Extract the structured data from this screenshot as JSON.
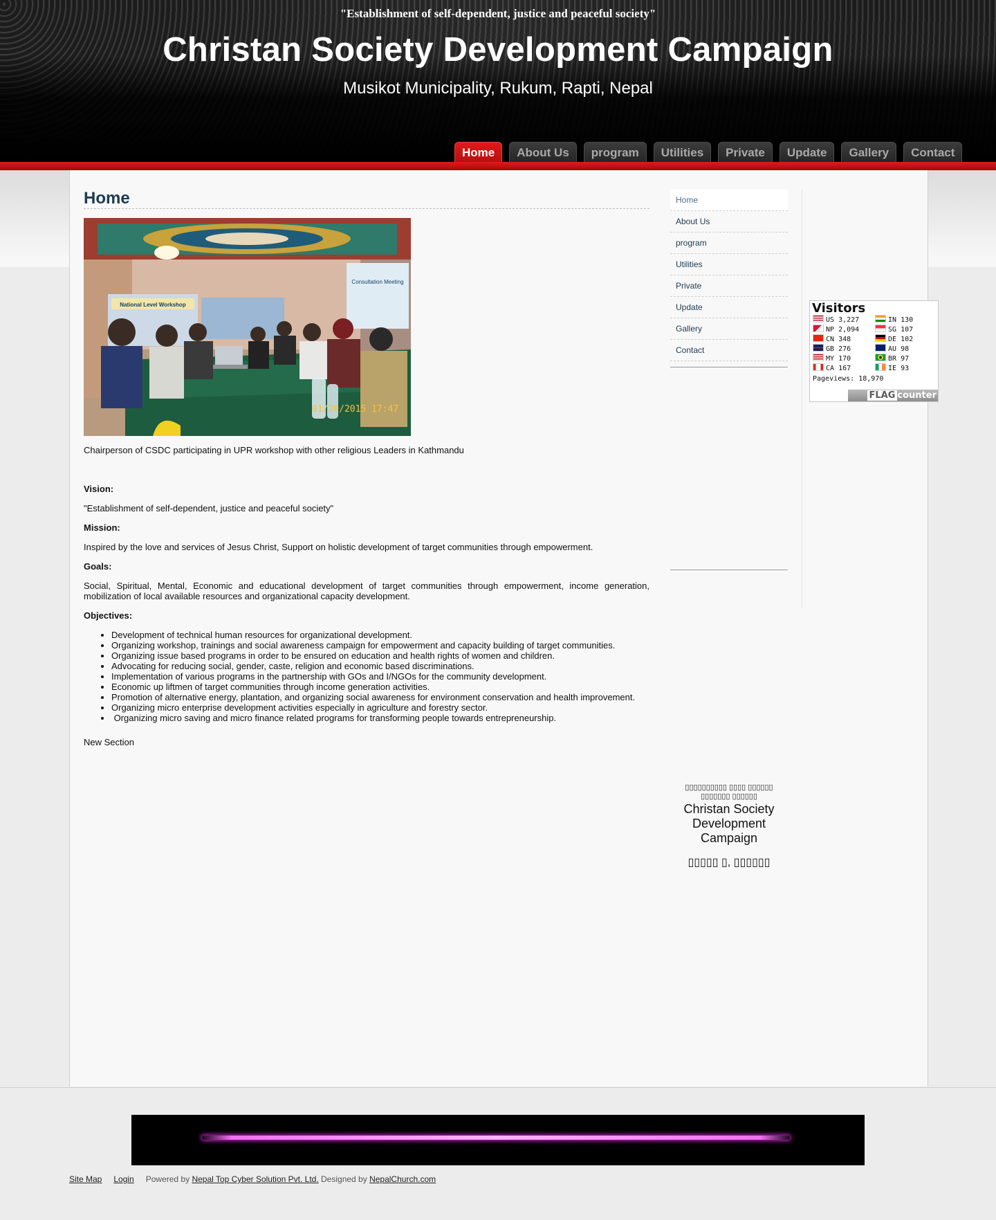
{
  "header": {
    "tagline": "\"Establishment of self-dependent, justice and peaceful society\"",
    "title": "Christan Society Development Campaign",
    "subtitle": "Musikot Municipality, Rukum, Rapti, Nepal"
  },
  "nav": {
    "items": [
      {
        "label": "Home",
        "active": true
      },
      {
        "label": "About Us"
      },
      {
        "label": "program"
      },
      {
        "label": "Utilities"
      },
      {
        "label": "Private"
      },
      {
        "label": "Update"
      },
      {
        "label": "Gallery"
      },
      {
        "label": "Contact"
      }
    ]
  },
  "main": {
    "heading": "Home",
    "photo_timestamp": "01/20/2015 17:47",
    "photo_banner": "National Level Workshop",
    "photo_banner2": "Consultation Meeting",
    "caption": "Chairperson of CSDC participating in UPR workshop with other religious Leaders in Kathmandu",
    "vision_label": "Vision:",
    "vision_text": "\"Establishment of self-dependent, justice and peaceful society\"",
    "mission_label": "Mission:",
    "mission_text": "Inspired by the love and services of Jesus Christ, Support on holistic development of target communities through empowerment.",
    "goals_label": "Goals:",
    "goals_text": "Social, Spiritual, Mental, Economic and educational development of target communities through empowerment, income generation, mobilization of local available resources and organizational capacity development.",
    "objectives_label": "Objectives:",
    "objectives": [
      "Development of technical human resources for organizational development.",
      "Organizing workshop, trainings and social awareness campaign for empowerment and capacity building of target communities.",
      "Organizing issue based programs in order to be ensured on education and health rights of women and children.",
      "Advocating for reducing social, gender, caste, religion and economic based discriminations.",
      "Implementation of various programs in the partnership with GOs and I/NGOs for the community development.",
      "Economic up liftmen of target communities through income generation activities.",
      "Promotion of alternative energy, plantation, and organizing social awareness for environment conservation and health improvement.",
      "Organizing micro enterprise development activities especially in agriculture and forestry sector.",
      " Organizing micro saving and micro finance related programs for transforming people towards entrepreneurship."
    ],
    "new_section": "New Section"
  },
  "sidebar": {
    "items": [
      {
        "label": "Home",
        "active": true
      },
      {
        "label": "About Us"
      },
      {
        "label": "program"
      },
      {
        "label": "Utilities"
      },
      {
        "label": "Private"
      },
      {
        "label": "Update"
      },
      {
        "label": "Gallery"
      },
      {
        "label": "Contact"
      }
    ],
    "nepali_name": "▯▯▯▯▯▯▯▯▯▯ ▯▯▯▯ ▯▯▯▯▯▯ ▯▯▯▯▯▯▯ ▯▯▯▯▯▯",
    "english_name": "Christan Society Development Campaign",
    "address_nepali": "▯▯▯▯▯ ▯, ▯▯▯▯▯▯"
  },
  "flag_counter": {
    "title": "Visitors",
    "rows_left": [
      {
        "code": "US",
        "count": "3,227",
        "flag": "us"
      },
      {
        "code": "NP",
        "count": "2,094",
        "flag": "np"
      },
      {
        "code": "CN",
        "count": "348",
        "flag": "cn"
      },
      {
        "code": "GB",
        "count": "276",
        "flag": "gb"
      },
      {
        "code": "MY",
        "count": "170",
        "flag": "my"
      },
      {
        "code": "CA",
        "count": "167",
        "flag": "ca"
      }
    ],
    "rows_right": [
      {
        "code": "IN",
        "count": "130",
        "flag": "in"
      },
      {
        "code": "SG",
        "count": "107",
        "flag": "sg"
      },
      {
        "code": "DE",
        "count": "102",
        "flag": "de"
      },
      {
        "code": "AU",
        "count": "98",
        "flag": "au"
      },
      {
        "code": "BR",
        "count": "97",
        "flag": "br"
      },
      {
        "code": "IE",
        "count": "93",
        "flag": "ie"
      }
    ],
    "pageviews_label": "Pageviews:",
    "pageviews": "18,970",
    "brand_flag": "FLAG",
    "brand_counter": "counter"
  },
  "footer": {
    "site_map": "Site Map",
    "login": "Login",
    "powered_by": "Powered by",
    "powered_link": "Nepal Top Cyber Solution Pvt. Ltd.",
    "designed_by": "Designed by",
    "designed_link": "NepalChurch.com"
  },
  "colors": {
    "nav_active": "#d41414",
    "red_bar": "#c80f0f",
    "heading": "#1e3a52"
  }
}
